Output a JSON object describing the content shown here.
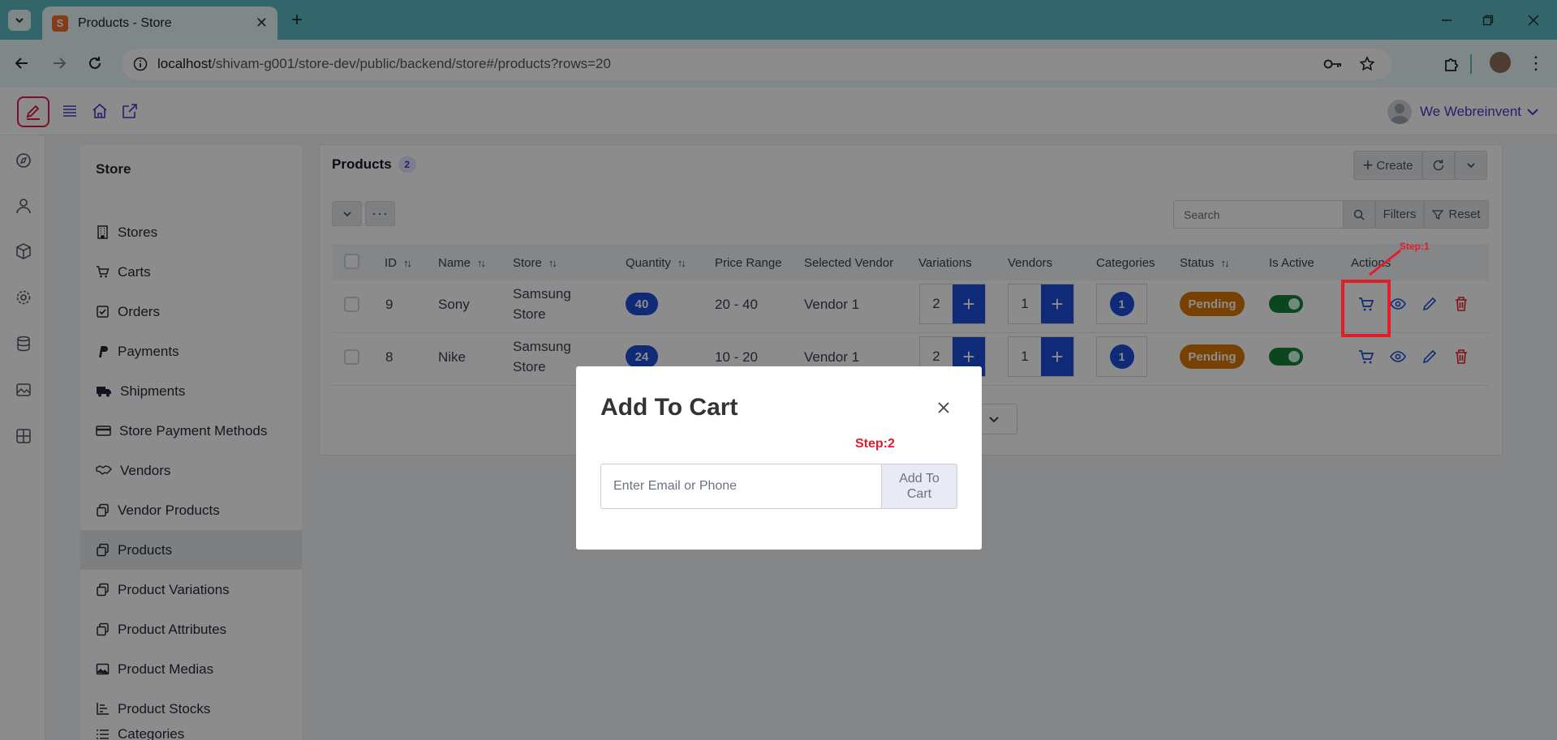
{
  "browser": {
    "tab_title": "Products - Store",
    "tab_icon_letter": "S",
    "url_host": "localhost",
    "url_path": "/shivam-g001/store-dev/public/backend/store#/products?rows=20"
  },
  "header": {
    "user_name": "We Webreinvent"
  },
  "sidebar": {
    "title": "Store",
    "items": [
      {
        "label": "Stores",
        "icon": "building-icon"
      },
      {
        "label": "Carts",
        "icon": "cart-icon"
      },
      {
        "label": "Orders",
        "icon": "check-square-icon"
      },
      {
        "label": "Payments",
        "icon": "paypal-icon"
      },
      {
        "label": "Shipments",
        "icon": "truck-icon"
      },
      {
        "label": "Store Payment Methods",
        "icon": "credit-card-icon"
      },
      {
        "label": "Vendors",
        "icon": "handshake-icon"
      },
      {
        "label": "Vendor Products",
        "icon": "copy-icon"
      },
      {
        "label": "Products",
        "icon": "copy-icon",
        "active": true
      },
      {
        "label": "Product Variations",
        "icon": "copy-icon"
      },
      {
        "label": "Product Attributes",
        "icon": "copy-icon"
      },
      {
        "label": "Product Medias",
        "icon": "image-icon"
      },
      {
        "label": "Product Stocks",
        "icon": "chart-icon"
      },
      {
        "label": "Categories",
        "icon": "list-icon"
      }
    ]
  },
  "panel": {
    "title": "Products",
    "count": "2",
    "create_label": "Create",
    "search_placeholder": "Search",
    "filters_label": "Filters",
    "reset_label": "Reset",
    "columns": [
      "ID",
      "Name",
      "Store",
      "Quantity",
      "Price Range",
      "Selected Vendor",
      "Variations",
      "Vendors",
      "Categories",
      "Status",
      "Is Active",
      "Actions"
    ],
    "rows": [
      {
        "id": "9",
        "name": "Sony",
        "store_line1": "Samsung",
        "store_line2": "Store",
        "quantity": "40",
        "price_range": "20 - 40",
        "vendor": "Vendor 1",
        "variations": "2",
        "vendors": "1",
        "categories": "1",
        "status": "Pending",
        "is_active": true
      },
      {
        "id": "8",
        "name": "Nike",
        "store_line1": "Samsung",
        "store_line2": "Store",
        "quantity": "24",
        "price_range": "10 - 20",
        "vendor": "Vendor 1",
        "variations": "2",
        "vendors": "1",
        "categories": "1",
        "status": "Pending",
        "is_active": true
      }
    ],
    "pagination_visible": "0"
  },
  "annotations": {
    "step1": "Step:1",
    "step2": "Step:2",
    "color": "#e11d2a"
  },
  "modal": {
    "title": "Add To Cart",
    "input_placeholder": "Enter Email or Phone",
    "button_line1": "Add To",
    "button_line2": "Cart"
  },
  "colors": {
    "titlebar": "#5bbbc2",
    "primary": "#1d4ed8",
    "pending": "#d97706",
    "active_toggle": "#15803d",
    "accent": "#4338ca"
  }
}
